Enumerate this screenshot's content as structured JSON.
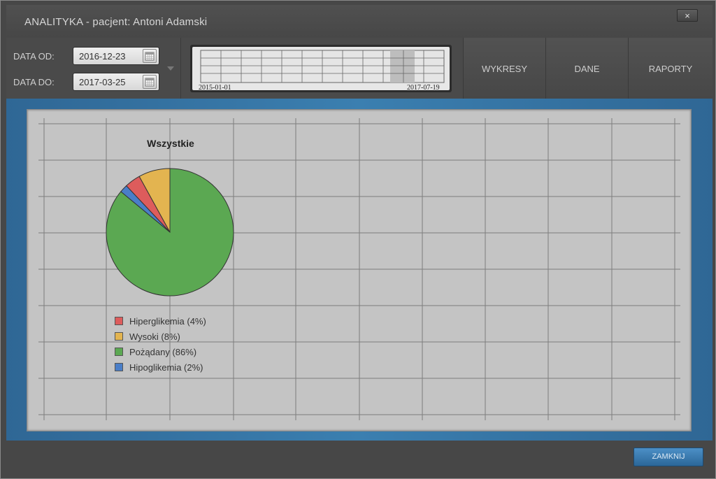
{
  "window": {
    "title": "ANALITYKA - pacjent: Antoni Adamski",
    "close_glyph": "×"
  },
  "filters": {
    "date_from_label": "DATA OD:",
    "date_from_value": "2016-12-23",
    "date_to_label": "DATA DO:",
    "date_to_value": "2017-03-25"
  },
  "timeline": {
    "start_label": "2015-01-01",
    "end_label": "2017-07-19"
  },
  "tabs": [
    {
      "label": "WYKRESY"
    },
    {
      "label": "DANE"
    },
    {
      "label": "RAPORTY"
    }
  ],
  "chart_data": {
    "type": "pie",
    "title": "Wszystkie",
    "series": [
      {
        "name": "Hiperglikemia (4%)",
        "value": 4,
        "color": "#dd5c5c"
      },
      {
        "name": "Wysoki (8%)",
        "value": 8,
        "color": "#e3b450"
      },
      {
        "name": "Pożądany (86%)",
        "value": 86,
        "color": "#5ba852"
      },
      {
        "name": "Hipoglikemia (2%)",
        "value": 2,
        "color": "#4a7ec8"
      }
    ],
    "legend_placement": "bottom-left"
  },
  "footer": {
    "close_label": "ZAMKNIJ"
  },
  "colors": {
    "accent": "#3b7fb0",
    "panel": "#c4c4c4"
  }
}
